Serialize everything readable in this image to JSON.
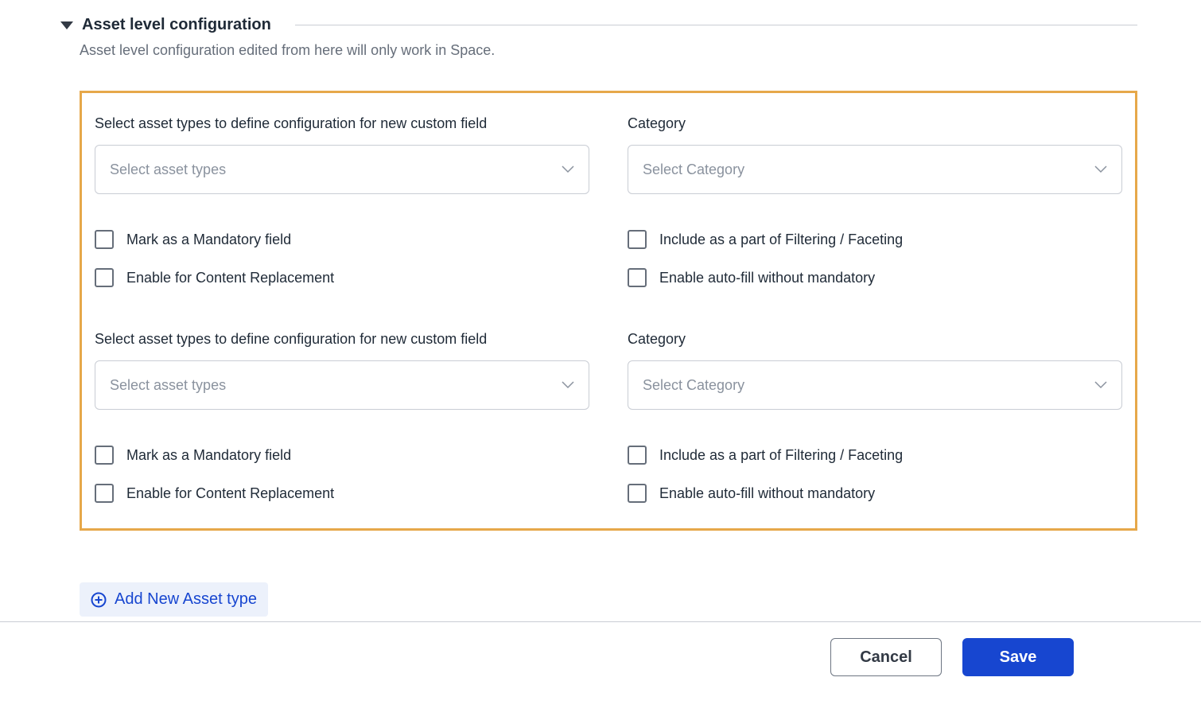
{
  "section": {
    "title": "Asset level configuration",
    "subtitle": "Asset level configuration edited from here will only work in Space."
  },
  "addNewLabel": "Add New Asset type",
  "footer": {
    "cancel": "Cancel",
    "save": "Save"
  },
  "configs": [
    {
      "assetTypes": {
        "label": "Select asset types to define configuration for new custom field",
        "placeholder": "Select asset types"
      },
      "category": {
        "label": "Category",
        "placeholder": "Select Category"
      },
      "checkboxes": {
        "mandatory": "Mark as a Mandatory field",
        "filtering": "Include as a part of Filtering / Faceting",
        "contentReplacement": "Enable for Content Replacement",
        "autofill": "Enable auto-fill without mandatory"
      }
    },
    {
      "assetTypes": {
        "label": "Select asset types to define configuration for new custom field",
        "placeholder": "Select asset types"
      },
      "category": {
        "label": "Category",
        "placeholder": "Select Category"
      },
      "checkboxes": {
        "mandatory": "Mark as a Mandatory field",
        "filtering": "Include as a part of Filtering / Faceting",
        "contentReplacement": "Enable for Content Replacement",
        "autofill": "Enable auto-fill without mandatory"
      }
    }
  ]
}
